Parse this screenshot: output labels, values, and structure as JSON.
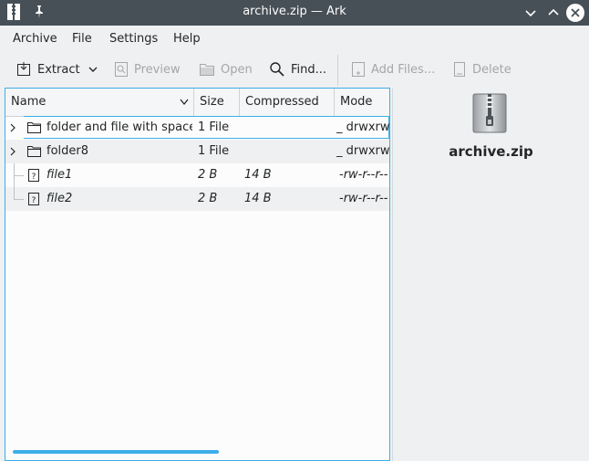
{
  "window": {
    "title": "archive.zip — Ark"
  },
  "menu": {
    "items": [
      "Archive",
      "File",
      "Settings",
      "Help"
    ]
  },
  "toolbar": {
    "extract": "Extract",
    "preview": "Preview",
    "open": "Open",
    "find": "Find...",
    "add_files": "Add Files...",
    "delete": "Delete"
  },
  "table": {
    "columns": [
      "Name",
      "Size",
      "Compressed",
      "Mode"
    ],
    "rows": [
      {
        "name": "folder and file with space",
        "size": "1 File",
        "compressed": "",
        "mode": "_ drwxrwxr",
        "type": "folder"
      },
      {
        "name": "folder8",
        "size": "1 File",
        "compressed": "",
        "mode": "_ drwxrwxr",
        "type": "folder"
      },
      {
        "name": "file1",
        "size": "2 B",
        "compressed": "14 B",
        "mode": "-rw-r--r--",
        "type": "file"
      },
      {
        "name": "file2",
        "size": "2 B",
        "compressed": "14 B",
        "mode": "-rw-r--r--",
        "type": "file"
      }
    ]
  },
  "info_panel": {
    "filename": "archive.zip"
  },
  "colors": {
    "titlebar": "#475057",
    "accent": "#3daee9",
    "window_bg": "#eff0f1"
  }
}
